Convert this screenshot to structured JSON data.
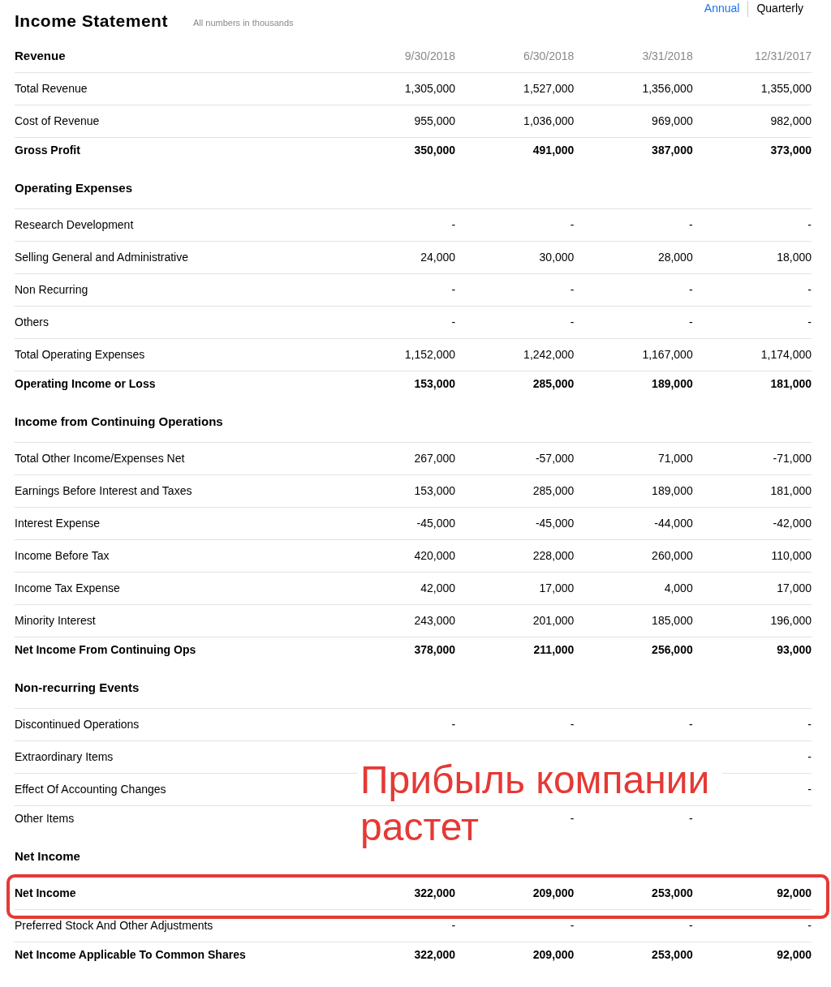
{
  "title": "Income Statement",
  "subtitle": "All numbers in thousands",
  "periods": [
    {
      "label": "Annual",
      "selected": false
    },
    {
      "label": "Quarterly",
      "selected": true
    }
  ],
  "columns": [
    "9/30/2018",
    "6/30/2018",
    "3/31/2018",
    "12/31/2017"
  ],
  "sections": [
    {
      "title": "Revenue",
      "rows": [
        {
          "label": "Total Revenue",
          "values": [
            "1,305,000",
            "1,527,000",
            "1,356,000",
            "1,355,000"
          ],
          "bold": false,
          "divider": true
        },
        {
          "label": "Cost of Revenue",
          "values": [
            "955,000",
            "1,036,000",
            "969,000",
            "982,000"
          ],
          "bold": false,
          "divider": true
        },
        {
          "label": "Gross Profit",
          "values": [
            "350,000",
            "491,000",
            "387,000",
            "373,000"
          ],
          "bold": true,
          "divider": false
        }
      ]
    },
    {
      "title": "Operating Expenses",
      "rows": [
        {
          "label": "Research Development",
          "values": [
            "-",
            "-",
            "-",
            "-"
          ],
          "bold": false,
          "divider": true
        },
        {
          "label": "Selling General and Administrative",
          "values": [
            "24,000",
            "30,000",
            "28,000",
            "18,000"
          ],
          "bold": false,
          "divider": true
        },
        {
          "label": "Non Recurring",
          "values": [
            "-",
            "-",
            "-",
            "-"
          ],
          "bold": false,
          "divider": true
        },
        {
          "label": "Others",
          "values": [
            "-",
            "-",
            "-",
            "-"
          ],
          "bold": false,
          "divider": true
        },
        {
          "label": "Total Operating Expenses",
          "values": [
            "1,152,000",
            "1,242,000",
            "1,167,000",
            "1,174,000"
          ],
          "bold": false,
          "divider": true
        },
        {
          "label": "Operating Income or Loss",
          "values": [
            "153,000",
            "285,000",
            "189,000",
            "181,000"
          ],
          "bold": true,
          "divider": false
        }
      ]
    },
    {
      "title": "Income from Continuing Operations",
      "rows": [
        {
          "label": "Total Other Income/Expenses Net",
          "values": [
            "267,000",
            "-57,000",
            "71,000",
            "-71,000"
          ],
          "bold": false,
          "divider": true
        },
        {
          "label": "Earnings Before Interest and Taxes",
          "values": [
            "153,000",
            "285,000",
            "189,000",
            "181,000"
          ],
          "bold": false,
          "divider": true
        },
        {
          "label": "Interest Expense",
          "values": [
            "-45,000",
            "-45,000",
            "-44,000",
            "-42,000"
          ],
          "bold": false,
          "divider": true
        },
        {
          "label": "Income Before Tax",
          "values": [
            "420,000",
            "228,000",
            "260,000",
            "110,000"
          ],
          "bold": false,
          "divider": true
        },
        {
          "label": "Income Tax Expense",
          "values": [
            "42,000",
            "17,000",
            "4,000",
            "17,000"
          ],
          "bold": false,
          "divider": true
        },
        {
          "label": "Minority Interest",
          "values": [
            "243,000",
            "201,000",
            "185,000",
            "196,000"
          ],
          "bold": false,
          "divider": true
        },
        {
          "label": "Net Income From Continuing Ops",
          "values": [
            "378,000",
            "211,000",
            "256,000",
            "93,000"
          ],
          "bold": true,
          "divider": false
        }
      ]
    },
    {
      "title": "Non-recurring Events",
      "rows": [
        {
          "label": "Discontinued Operations",
          "values": [
            "-",
            "-",
            "-",
            "-"
          ],
          "bold": false,
          "divider": true
        },
        {
          "label": "Extraordinary Items",
          "values": {
            "column_4": "-"
          },
          "bold": false,
          "divider": true
        },
        {
          "label": "Effect Of Accounting Changes",
          "values": {
            "column_4": "-"
          },
          "bold": false,
          "divider": true
        },
        {
          "label": "Other Items",
          "values": {
            "column_2": "-",
            "column_3": "-"
          },
          "bold": false,
          "divider": false
        }
      ]
    },
    {
      "title": "Net Income",
      "rows": [
        {
          "label": "Net Income",
          "values": [
            "322,000",
            "209,000",
            "253,000",
            "92,000"
          ],
          "bold": true,
          "divider": true,
          "highlighted": true
        },
        {
          "label": "Preferred Stock And Other Adjustments",
          "values": [
            "-",
            "-",
            "-",
            "-"
          ],
          "bold": false,
          "divider": true
        },
        {
          "label": "Net Income Applicable To Common Shares",
          "values": [
            "322,000",
            "209,000",
            "253,000",
            "92,000"
          ],
          "bold": true,
          "divider": false
        }
      ]
    }
  ],
  "annotation": {
    "text": "Прибыль компании растет"
  }
}
